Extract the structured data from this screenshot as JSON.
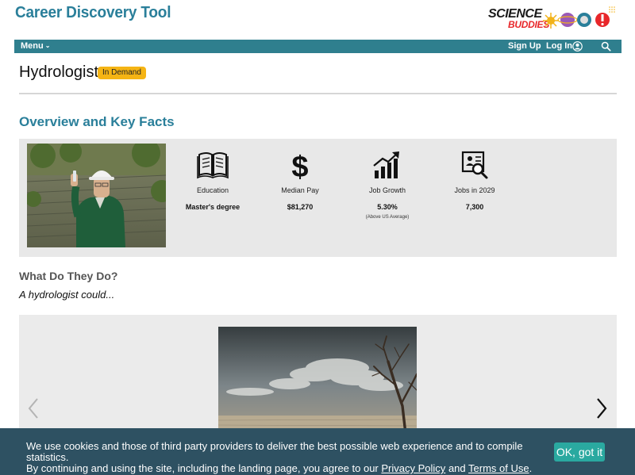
{
  "header": {
    "site_title": "Career Discovery Tool",
    "logo_word_1": "SCIENCE",
    "logo_word_2": "BUDDIES",
    "logo_colors": [
      "#f2b31a",
      "#9b59b6",
      "#2a7f9a",
      "#e8272a"
    ]
  },
  "nav": {
    "menu_label": "Menu",
    "menu_caret": "⌄",
    "sign_up": "Sign Up",
    "log_in": "Log In",
    "bg_color": "#2f7f8e"
  },
  "career": {
    "title": "Hydrologist",
    "badge": "In Demand",
    "badge_color": "#f5b414"
  },
  "overview": {
    "heading": "Overview and Key Facts",
    "facts": [
      {
        "icon": "book-icon",
        "label": "Education",
        "value": "Master's degree",
        "note": ""
      },
      {
        "icon": "dollar-icon",
        "label": "Median Pay",
        "value": "$81,270",
        "note": ""
      },
      {
        "icon": "growth-chart-icon",
        "label": "Job Growth",
        "value": "5.30%",
        "note": "(Above US Average)"
      },
      {
        "icon": "job-search-icon",
        "label": "Jobs in 2029",
        "value": "7,300",
        "note": ""
      }
    ]
  },
  "what_they_do": {
    "heading": "What Do They Do?",
    "subheading": "A hydrologist could..."
  },
  "carousel": {
    "prev_icon": "chevron-left-icon",
    "next_icon": "chevron-right-icon"
  },
  "cookie_banner": {
    "line1": "We use cookies and those of third party providers to deliver the best possible web experience and to compile statistics.",
    "line2_before": "By continuing and using the site, including the landing page, you agree to our",
    "privacy_link": "Privacy Policy",
    "and": "and",
    "terms_link": "Terms of Use",
    "period": ".",
    "ok_button": "OK, got it",
    "bg_color": "#2e5162",
    "button_color": "#2aa9a0"
  }
}
